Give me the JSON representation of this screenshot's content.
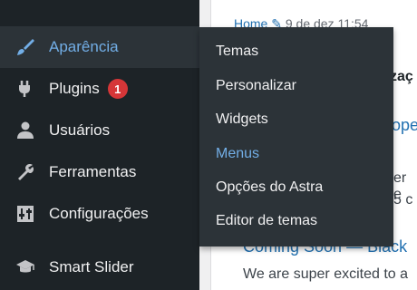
{
  "sidebar": {
    "items": [
      {
        "label": "Aparência",
        "icon": "brush-icon",
        "active": true
      },
      {
        "label": "Plugins",
        "icon": "plugin-icon",
        "badge": "1"
      },
      {
        "label": "Usuários",
        "icon": "user-icon"
      },
      {
        "label": "Ferramentas",
        "icon": "wrench-icon"
      },
      {
        "label": "Configurações",
        "icon": "settings-icon"
      },
      {
        "label": "Smart Slider",
        "icon": "graduation-cap-icon"
      }
    ]
  },
  "submenu": {
    "items": [
      {
        "label": "Temas"
      },
      {
        "label": "Personalizar"
      },
      {
        "label": "Widgets"
      },
      {
        "label": "Menus",
        "current": true
      },
      {
        "label": "Opções do Astra"
      },
      {
        "label": "Editor de temas"
      }
    ]
  },
  "main": {
    "breadcrumb_home": "Home",
    "breadcrumb_date": "9 de dez 11:54",
    "heading_fragment": "zaç",
    "link_fragment": "ope",
    "text_fragment_1": "er e",
    "text_fragment_2": "5 c",
    "post_title": "Coming Soon — Black",
    "post_excerpt": "We are super excited to a"
  },
  "colors": {
    "sidebar_bg": "#1d2327",
    "flyout_bg": "#2c3338",
    "accent": "#72aee6",
    "badge": "#d63638",
    "link": "#2271b1"
  }
}
